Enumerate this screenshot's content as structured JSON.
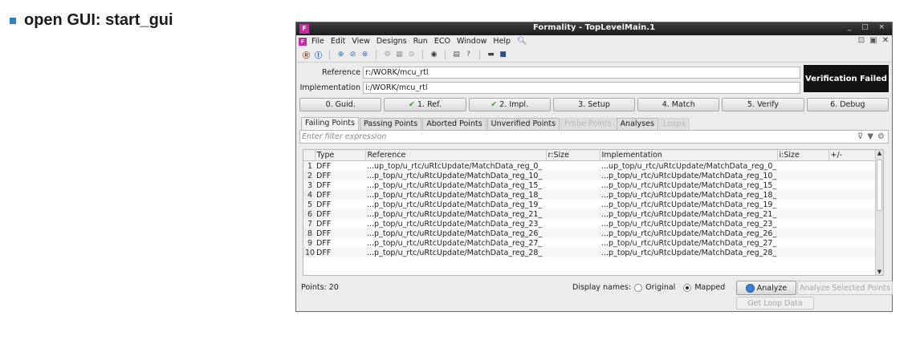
{
  "slide": {
    "bullet_text": "open GUI: start_gui"
  },
  "window": {
    "title": "Formality - TopLevelMain.1",
    "logo": "F",
    "controls": "_ □ ×"
  },
  "menu": [
    "File",
    "Edit",
    "View",
    "Designs",
    "Run",
    "ECO",
    "Window",
    "Help"
  ],
  "toolbar_icons": [
    "ref-icon",
    "impl-icon",
    "target-icon",
    "check-circle-icon",
    "no-circle-icon",
    "gear-icon",
    "grid-icon",
    "zoom-icon",
    "binoculars-icon",
    "doc-icon",
    "help-icon",
    "folder-icon",
    "save-icon"
  ],
  "fields": {
    "reference_label": "Reference",
    "reference_value": "r:/WORK/mcu_rtl",
    "implementation_label": "Implementation",
    "implementation_value": "i:/WORK/mcu_rtl"
  },
  "status": "Verification Failed",
  "flow_steps": [
    {
      "label": "0. Guid.",
      "done": false
    },
    {
      "label": "1. Ref.",
      "done": true
    },
    {
      "label": "2. Impl.",
      "done": true
    },
    {
      "label": "3. Setup",
      "done": false
    },
    {
      "label": "4. Match",
      "done": false
    },
    {
      "label": "5. Verify",
      "done": false
    },
    {
      "label": "6. Debug",
      "done": false
    }
  ],
  "tabs": [
    {
      "label": "Failing Points",
      "state": "active"
    },
    {
      "label": "Passing Points",
      "state": "normal"
    },
    {
      "label": "Aborted Points",
      "state": "normal"
    },
    {
      "label": "Unverified Points",
      "state": "normal"
    },
    {
      "label": "Probe Points",
      "state": "disabled"
    },
    {
      "label": "Analyses",
      "state": "normal"
    },
    {
      "label": "Loops",
      "state": "disabled"
    }
  ],
  "filter": {
    "placeholder": "Enter filter expression"
  },
  "table": {
    "columns": [
      "",
      "Type",
      "Reference",
      "r:Size",
      "Implementation",
      "i:Size",
      "+/-"
    ],
    "rows": [
      [
        "1",
        "DFF",
        "...up_top/u_rtc/uRtcUpdate/MatchData_reg_0_",
        "",
        "...up_top/u_rtc/uRtcUpdate/MatchData_reg_0_",
        "",
        ""
      ],
      [
        "2",
        "DFF",
        "...p_top/u_rtc/uRtcUpdate/MatchData_reg_10_",
        "",
        "...p_top/u_rtc/uRtcUpdate/MatchData_reg_10_",
        "",
        ""
      ],
      [
        "3",
        "DFF",
        "...p_top/u_rtc/uRtcUpdate/MatchData_reg_15_",
        "",
        "...p_top/u_rtc/uRtcUpdate/MatchData_reg_15_",
        "",
        ""
      ],
      [
        "4",
        "DFF",
        "...p_top/u_rtc/uRtcUpdate/MatchData_reg_18_",
        "",
        "...p_top/u_rtc/uRtcUpdate/MatchData_reg_18_",
        "",
        ""
      ],
      [
        "5",
        "DFF",
        "...p_top/u_rtc/uRtcUpdate/MatchData_reg_19_",
        "",
        "...p_top/u_rtc/uRtcUpdate/MatchData_reg_19_",
        "",
        ""
      ],
      [
        "6",
        "DFF",
        "...p_top/u_rtc/uRtcUpdate/MatchData_reg_21_",
        "",
        "...p_top/u_rtc/uRtcUpdate/MatchData_reg_21_",
        "",
        ""
      ],
      [
        "7",
        "DFF",
        "...p_top/u_rtc/uRtcUpdate/MatchData_reg_23_",
        "",
        "...p_top/u_rtc/uRtcUpdate/MatchData_reg_23_",
        "",
        ""
      ],
      [
        "8",
        "DFF",
        "...p_top/u_rtc/uRtcUpdate/MatchData_reg_26_",
        "",
        "...p_top/u_rtc/uRtcUpdate/MatchData_reg_26_",
        "",
        ""
      ],
      [
        "9",
        "DFF",
        "...p_top/u_rtc/uRtcUpdate/MatchData_reg_27_",
        "",
        "...p_top/u_rtc/uRtcUpdate/MatchData_reg_27_",
        "",
        ""
      ],
      [
        "10",
        "DFF",
        "...p_top/u_rtc/uRtcUpdate/MatchData_reg_28_",
        "",
        "...p_top/u_rtc/uRtcUpdate/MatchData_reg_28_",
        "",
        ""
      ]
    ]
  },
  "bottom": {
    "points": "Points: 20",
    "display_names_label": "Display names:",
    "original": "Original",
    "mapped": "Mapped",
    "selected_display": "Mapped",
    "analyze": "Analyze",
    "analyze_selected": "Analyze Selected Points",
    "get_loop_data": "Get Loop Data"
  }
}
